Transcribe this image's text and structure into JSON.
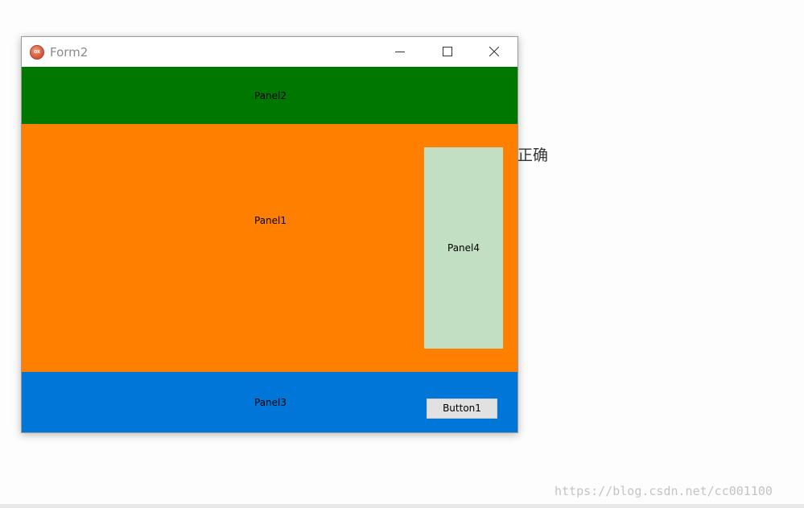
{
  "window": {
    "title": "Form2",
    "icon": "app-icon",
    "controls": {
      "minimize_icon": "minimize-icon",
      "maximize_icon": "maximize-icon",
      "close_icon": "close-icon"
    }
  },
  "panels": {
    "panel2": {
      "label": "Panel2",
      "color": "#007800"
    },
    "panel1": {
      "label": "Panel1",
      "color": "#ff7f00"
    },
    "panel4": {
      "label": "Panel4",
      "color": "#c3dfc3"
    },
    "panel3": {
      "label": "Panel3",
      "color": "#0077d8"
    }
  },
  "button1": {
    "label": "Button1"
  },
  "annotation": {
    "text": "正确"
  },
  "watermark": {
    "text": "https://blog.csdn.net/cc001100"
  }
}
